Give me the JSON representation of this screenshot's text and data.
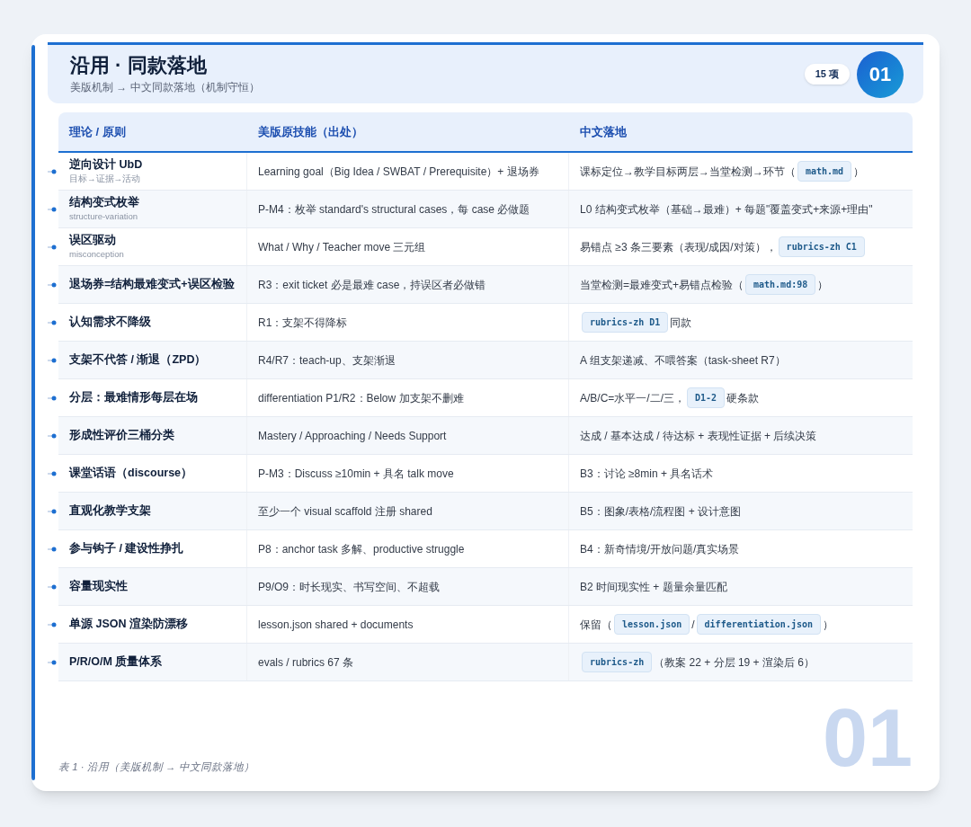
{
  "header": {
    "title": "沿用 · 同款落地",
    "subtitle": "美版机制 → 中文同款落地（机制守恒）",
    "badge": "01",
    "count": "15 项"
  },
  "table": {
    "columns": [
      "理论 / 原则",
      "美版原技能（出处）",
      "中文落地"
    ],
    "rows": [
      {
        "principle": "逆向设计 UbD",
        "note": "目标→证据→活动",
        "source": "Learning goal（Big Idea / SWBAT / Prerequisite）+ 退场券",
        "landing": [
          {
            "kind": "text",
            "text": "课标定位→教学目标两层→当堂检测→环节（"
          },
          {
            "kind": "code",
            "text": "math.md"
          },
          {
            "kind": "text",
            "text": "）"
          }
        ]
      },
      {
        "principle": "结构变式枚举",
        "note": "structure-variation",
        "source": "P-M4：枚举 standard's structural cases，每 case 必做题",
        "landing": [
          {
            "kind": "text",
            "text": "L0 结构变式枚举（基础→最难）+ 每题\"覆盖变式+来源+理由\""
          }
        ]
      },
      {
        "principle": "误区驱动",
        "note": "misconception",
        "source": "What / Why / Teacher move 三元组",
        "landing": [
          {
            "kind": "text",
            "text": "易错点 ≥3 条三要素（表现/成因/对策），"
          },
          {
            "kind": "code",
            "text": "rubrics-zh C1"
          }
        ]
      },
      {
        "principle": "退场券=结构最难变式+误区检验",
        "source": "R3：exit ticket 必是最难 case，持误区者必做错",
        "landing": [
          {
            "kind": "text",
            "text": "当堂检测=最难变式+易错点检验（"
          },
          {
            "kind": "code",
            "text": "math.md:98"
          },
          {
            "kind": "text",
            "text": "）"
          }
        ]
      },
      {
        "principle": "认知需求不降级",
        "source": "R1：支架不得降标",
        "landing": [
          {
            "kind": "code",
            "text": "rubrics-zh D1"
          },
          {
            "kind": "text",
            "text": "同款"
          }
        ]
      },
      {
        "principle": "支架不代答 / 渐退（ZPD）",
        "source": "R4/R7：teach-up、支架渐退",
        "landing": [
          {
            "kind": "text",
            "text": "A 组支架递减、不喂答案（task-sheet R7）"
          }
        ]
      },
      {
        "principle": "分层：最难情形每层在场",
        "source": "differentiation P1/R2：Below 加支架不删难",
        "landing": [
          {
            "kind": "text",
            "text": "A/B/C=水平一/二/三，"
          },
          {
            "kind": "code",
            "text": "D1-2"
          },
          {
            "kind": "text",
            "text": "硬条款"
          }
        ]
      },
      {
        "principle": "形成性评价三桶分类",
        "source": "Mastery / Approaching / Needs Support",
        "landing": [
          {
            "kind": "text",
            "text": "达成 / 基本达成 / 待达标 + 表现性证据 + 后续决策"
          }
        ]
      },
      {
        "principle": "课堂话语（discourse）",
        "source": "P-M3：Discuss ≥10min + 具名 talk move",
        "landing": [
          {
            "kind": "text",
            "text": "B3：讨论 ≥8min + 具名话术"
          }
        ]
      },
      {
        "principle": "直观化教学支架",
        "source": "至少一个 visual scaffold 注册 shared",
        "landing": [
          {
            "kind": "text",
            "text": "B5：图象/表格/流程图 + 设计意图"
          }
        ]
      },
      {
        "principle": "参与钩子 / 建设性挣扎",
        "source": "P8：anchor task 多解、productive struggle",
        "landing": [
          {
            "kind": "text",
            "text": "B4：新奇情境/开放问题/真实场景"
          }
        ]
      },
      {
        "principle": "容量现实性",
        "source": "P9/O9：时长现实、书写空间、不超载",
        "landing": [
          {
            "kind": "text",
            "text": "B2 时间现实性 + 题量余量匹配"
          }
        ]
      },
      {
        "principle": "单源 JSON 渲染防漂移",
        "source": "lesson.json shared + documents",
        "landing": [
          {
            "kind": "text",
            "text": "保留（"
          },
          {
            "kind": "code",
            "text": "lesson.json"
          },
          {
            "kind": "text",
            "text": "/"
          },
          {
            "kind": "code",
            "text": "differentiation.json"
          },
          {
            "kind": "text",
            "text": "）"
          }
        ]
      },
      {
        "principle": "P/R/O/M 质量体系",
        "source": "evals / rubrics 67 条",
        "landing": [
          {
            "kind": "code",
            "text": "rubrics-zh"
          },
          {
            "kind": "text",
            "text": "（教案 22 + 分层 19 + 渲染后 6）"
          }
        ]
      }
    ]
  },
  "caption": "表 1 · 沿用（美版机制 → 中文同款落地）",
  "watermark": "01"
}
